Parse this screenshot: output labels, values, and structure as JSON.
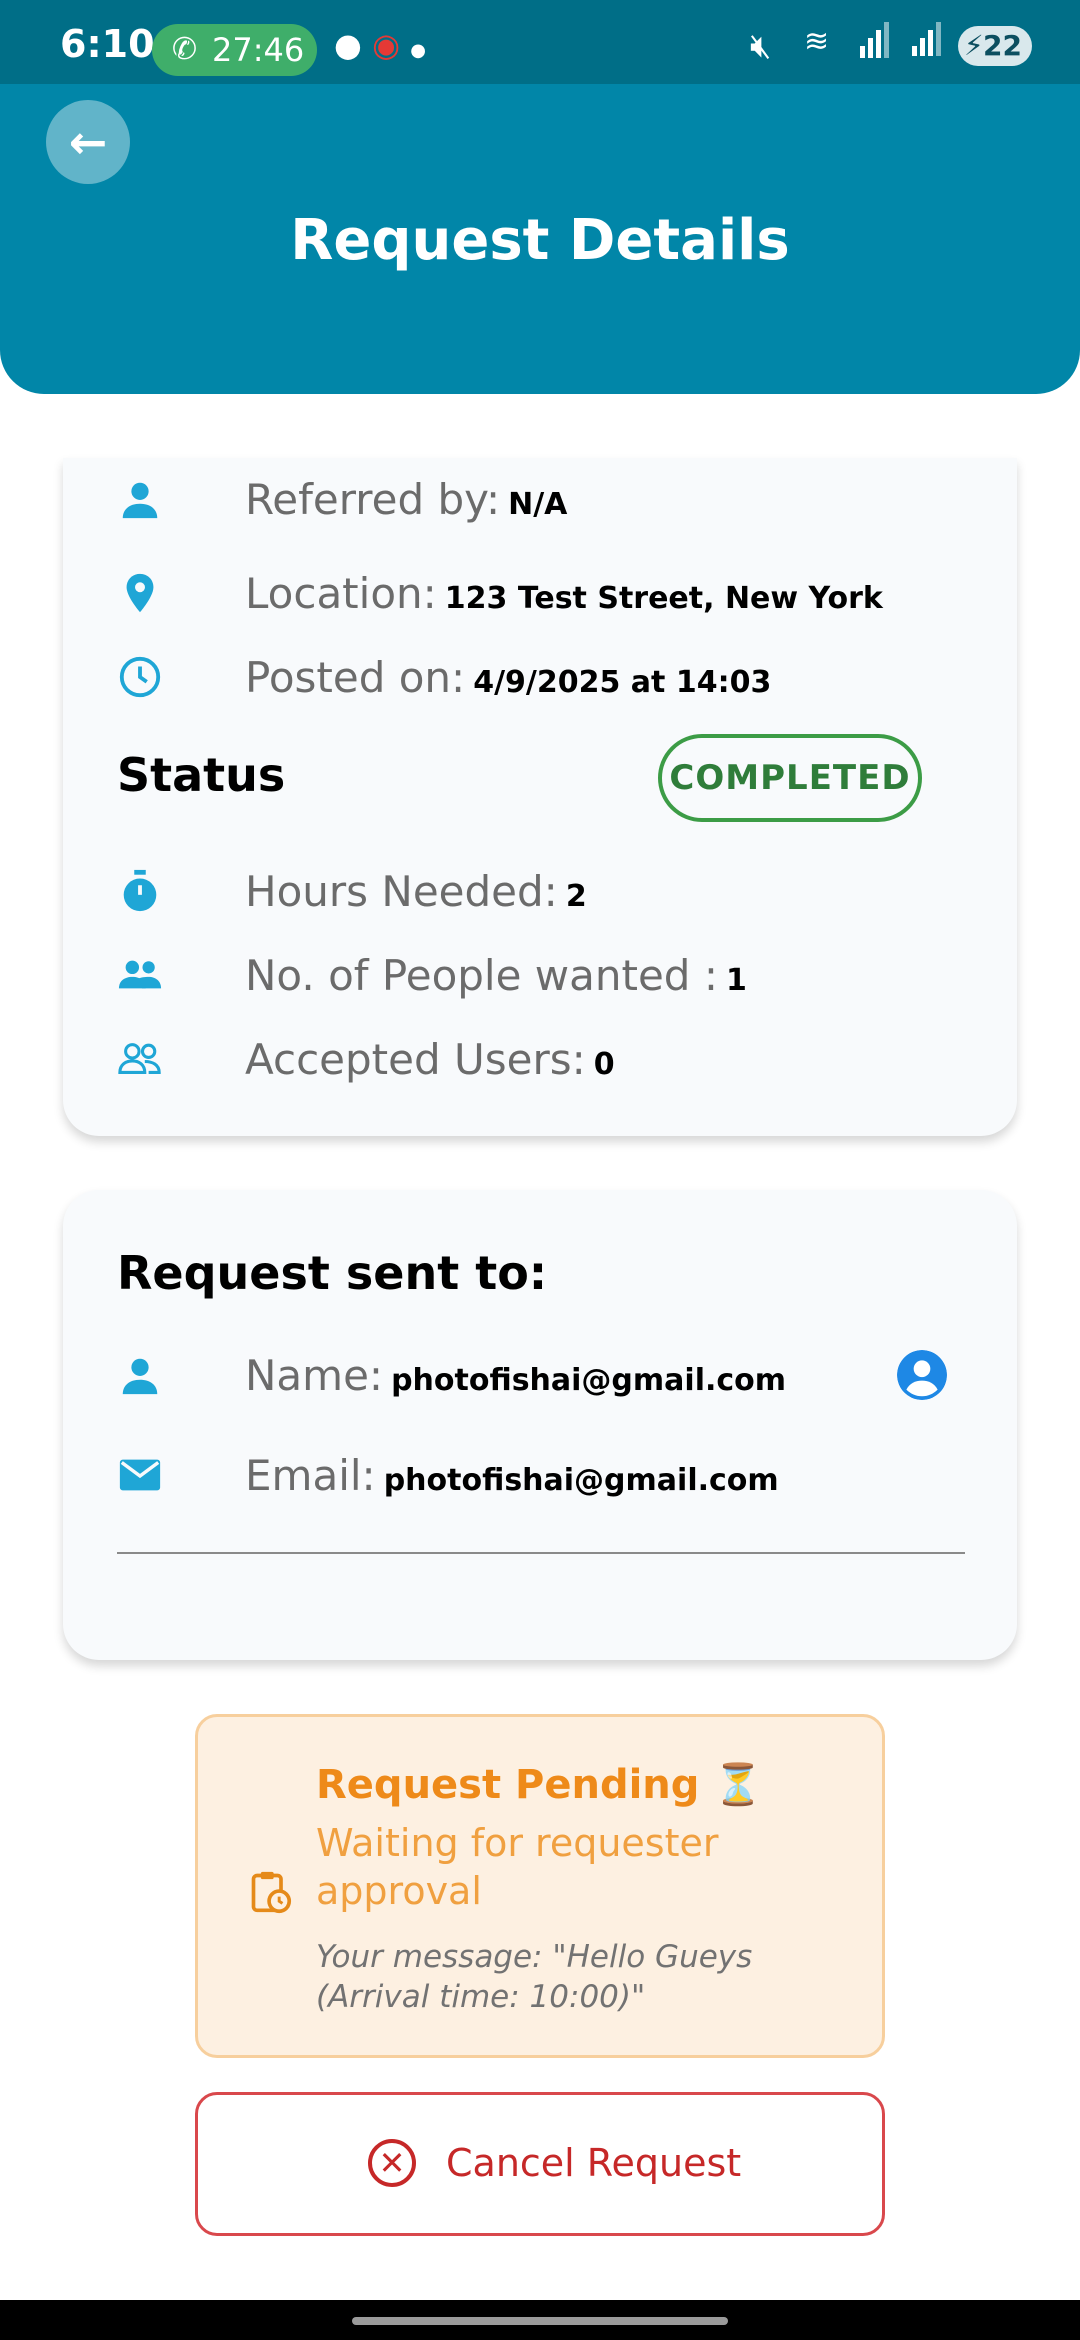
{
  "status_bar": {
    "time": "6:10",
    "call_duration": "27:46",
    "battery": "22"
  },
  "header": {
    "title": "Request Details"
  },
  "details": {
    "referred_by_label": "Referred by:",
    "referred_by": "N/A",
    "location_label": "Location:",
    "location": "123 Test Street, New York",
    "posted_on_label": "Posted on:",
    "posted_on": "4/9/2025 at 14:03",
    "status_label": "Status",
    "status_value": "COMPLETED",
    "hours_label": "Hours Needed:",
    "hours": "2",
    "people_label": "No. of People wanted :",
    "people": "1",
    "accepted_label": "Accepted Users:",
    "accepted": "0"
  },
  "recipient": {
    "title": "Request sent to:",
    "name_label": "Name:",
    "name": "photofishai@gmail.com",
    "email_label": "Email:",
    "email": "photofishai@gmail.com"
  },
  "pending": {
    "title": "Request Pending ⏳",
    "subtitle": "Waiting for requester approval",
    "message": "Your message: \"Hello Gueys (Arrival time: 10:00)\""
  },
  "cancel": {
    "label": "Cancel Request"
  },
  "colors": {
    "header": "#0186a8",
    "status_bar": "#006e87",
    "completed": "#2f7d3a",
    "pending": "#ee8a19",
    "cancel": "#c62828",
    "icon": "#1fa6d6"
  }
}
